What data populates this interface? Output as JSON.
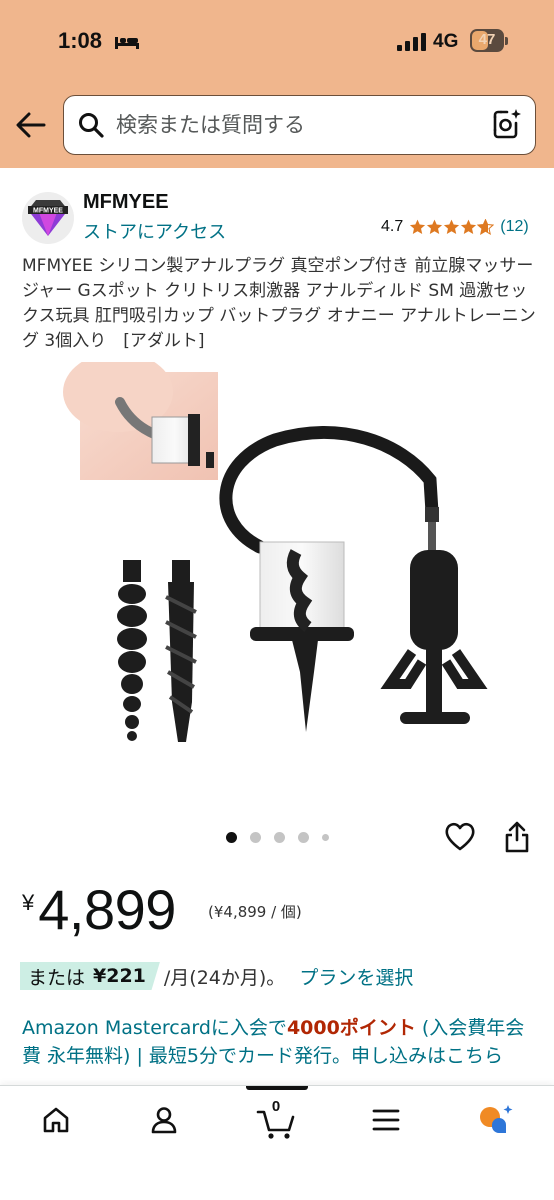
{
  "status_bar": {
    "time": "1:08",
    "network": "4G",
    "battery": "47"
  },
  "search": {
    "placeholder": "検索または質問する"
  },
  "store": {
    "name": "MFMYEE",
    "logo_text": "MFMYEE",
    "link": "ストアにアクセス",
    "rating": "4.7",
    "stars": 4.7,
    "review_count": "(12)"
  },
  "product": {
    "title": "MFMYEE シリコン製アナルプラグ 真空ポンプ付き 前立腺マッサージャー Gスポット クリトリス刺激器 アナルディルド SM 過激セックス玩具 肛門吸引カップ バットプラグ オナニー アナルトレーニング 3個入り　[アダルト]",
    "image_count": 5,
    "image_index": 1
  },
  "price": {
    "currency": "¥",
    "amount": "4,899",
    "unit_price": "(¥4,899 / 個)"
  },
  "installment": {
    "prefix": "または",
    "amount": "¥221",
    "term": "/月(24か月)。",
    "link": "プランを選択"
  },
  "promo": {
    "text_before": "Amazon Mastercardに入会で",
    "points": "4000ポイント",
    "text_after": " (入会費年会費 永年無料) | 最短5分でカード発行。申し込みはこちら"
  },
  "bottom_nav": {
    "items": [
      "home-icon",
      "account-icon",
      "cart-icon",
      "menu-icon",
      "rufus-icon"
    ],
    "cart_count": "0"
  },
  "colors": {
    "header_bg": "#f0b68d",
    "link": "#007185",
    "star": "#de7921",
    "points": "#b12704",
    "installment_bg": "#cdeee4"
  }
}
